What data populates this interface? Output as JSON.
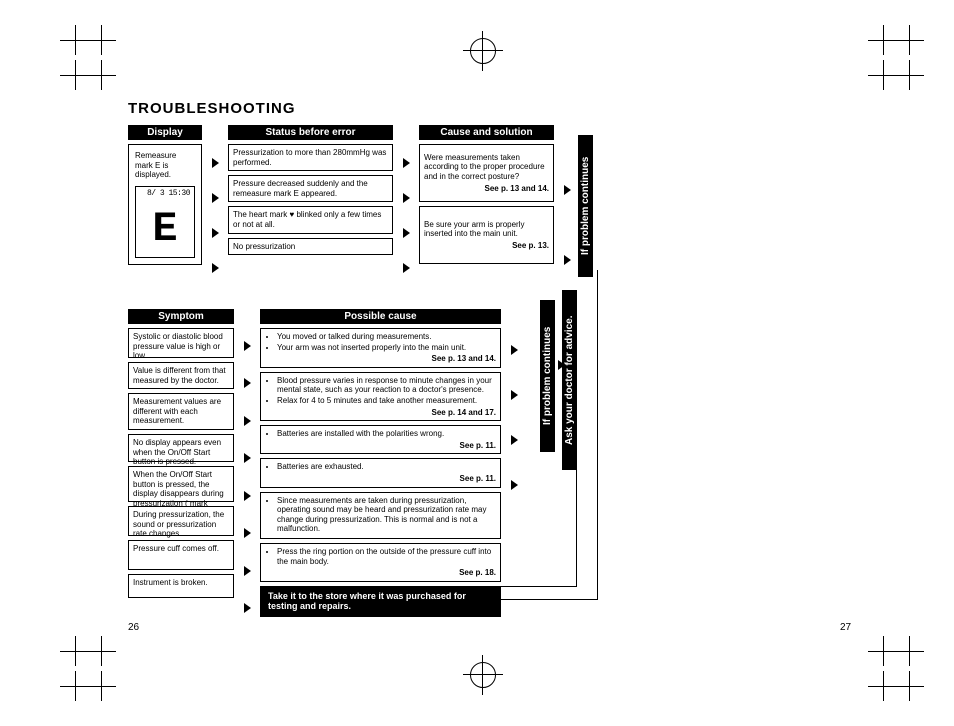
{
  "title": "TROUBLESHOOTING",
  "headers": {
    "display": "Display",
    "status": "Status before error",
    "cause": "Cause and solution",
    "symptom": "Symptom",
    "possible": "Possible cause"
  },
  "lcd": {
    "caption": "Remeasure mark  E  is displayed.",
    "time": "8/  3  15:30",
    "mark": "E"
  },
  "status_items": [
    "Pressurization to more than 280mmHg was performed.",
    "Pressure decreased suddenly and the remeasure mark  E  appeared.",
    "The heart mark  ♥  blinked only a few times or not at all.",
    "No pressurization"
  ],
  "cause_items": [
    {
      "text": "Were measurements taken according to the proper procedure and in the correct posture?",
      "ref": "See p. 13 and 14."
    },
    {
      "text": "Be sure your arm is properly inserted into the main unit.",
      "ref": "See p. 13."
    }
  ],
  "vlabels": {
    "continues1": "If problem continues",
    "continues2": "If problem continues",
    "ask": "Ask your doctor for advice."
  },
  "symptoms": [
    "Systolic or diastolic blood pressure value is high or low.",
    "Value is different from that measured by the doctor.",
    "Measurement values are different with each measurement.",
    "No display appears even when the On/Off Start button is pressed.",
    "When the On/Off Start button  is pressed, the display disappears during pressurization (      mark apears).",
    "During pressurization, the sound or pressurization rate changes.",
    "Pressure cuff comes off.",
    "Instrument is broken."
  ],
  "possible": [
    {
      "bullets": [
        "You moved or  talked during measurements.",
        "Your arm was not inserted properly into the main unit."
      ],
      "ref": "See p. 13 and 14."
    },
    {
      "bullets": [
        "Blood pressure varies in response to minute changes in your mental state, such as your reaction to a doctor's presence.",
        "Relax for 4 to 5 minutes and take another measurement."
      ],
      "ref": "See p. 14 and 17."
    },
    {
      "bullets": [
        "Batteries are installed with the polarities wrong."
      ],
      "ref": "See p. 11."
    },
    {
      "bullets": [
        "Batteries are exhausted."
      ],
      "ref": "See p. 11."
    },
    {
      "bullets": [
        "Since measurements are taken during pressurization, operating sound may be heard and pressurization rate may change during pressurization. This is normal and is not a malfunction."
      ],
      "ref": ""
    },
    {
      "bullets": [
        "Press the ring portion on the outside of the pressure cuff into the main body."
      ],
      "ref": "See p. 18."
    }
  ],
  "takeit": "Take it to the store where it was purchased for testing and repairs.",
  "pageLeft": "26",
  "pageRight": "27"
}
